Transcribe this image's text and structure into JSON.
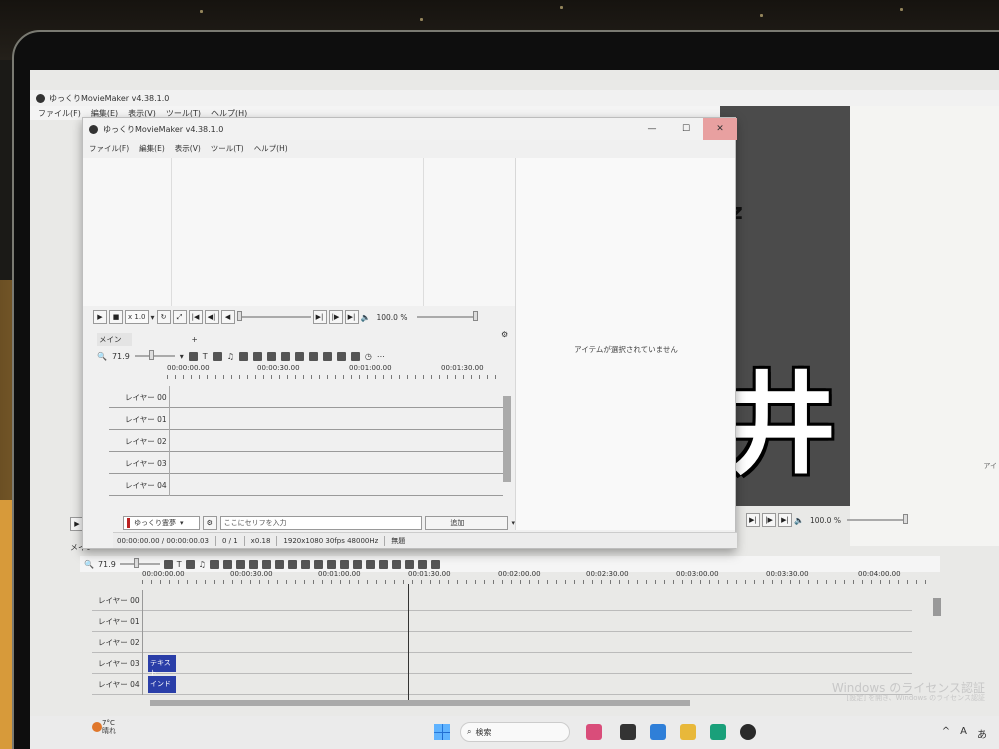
{
  "app": {
    "title": "ゆっくりMovieMaker v4.38.1.0",
    "menu": [
      "ファイル(F)",
      "編集(E)",
      "表示(V)",
      "ツール(T)",
      "ヘルプ(H)"
    ]
  },
  "front_window": {
    "title": "ゆっくりMovieMaker v4.38.1.0",
    "window_buttons": {
      "minimize": "—",
      "maximize": "☐",
      "close": "✕"
    },
    "menu": [
      "ファイル(F)",
      "編集(E)",
      "表示(V)",
      "ツール(T)",
      "ヘルプ(H)"
    ],
    "playback": {
      "speed": "x 1.0",
      "volume": "100.0 %"
    },
    "tabs": {
      "main": "メイン",
      "add": "+"
    },
    "zoom": "71.9",
    "ruler": [
      "00:00:00.00",
      "00:00:30.00",
      "00:01:00.00",
      "00:01:30.00"
    ],
    "layers": [
      "レイヤー 00",
      "レイヤー 01",
      "レイヤー 02",
      "レイヤー 03",
      "レイヤー 04"
    ],
    "character": "ゆっくり霊夢",
    "speech_placeholder": "ここにセリフを入力",
    "add_button": "追加",
    "status": {
      "time": "00:00:00.00 / 00:00:00.03",
      "frame": "0 / 1",
      "scale": "x0.18",
      "format": "1920x1080 30fps 48000Hz",
      "project": "無題"
    },
    "properties_empty": "アイテムが選択されていません"
  },
  "back_window": {
    "tab_main": "メイン",
    "zoom": "71.9",
    "volume": "100.0 %",
    "ruler": [
      "00:00:00.00",
      "00:00:30.00",
      "00:01:00.00",
      "00:01:30.00",
      "00:02:00.00",
      "00:02:30.00",
      "00:03:00.00",
      "00:03:30.00",
      "00:04:00.00"
    ],
    "layers": [
      "レイヤー 00",
      "レイヤー 01",
      "レイヤー 02",
      "レイヤー 03",
      "レイヤー 04"
    ],
    "clips": [
      {
        "layer": 3,
        "label": "テキスト"
      },
      {
        "layer": 4,
        "label": "インド"
      }
    ],
    "right_panel_stub": "アイ",
    "preview_glyph": "井",
    "preview_glyph_top": "z"
  },
  "watermark": {
    "line1": "Windows のライセンス認証",
    "line2": "[設定] を開き、Windows のライセンス認証"
  },
  "taskbar": {
    "weather_temp": "7°C",
    "weather_desc": "晴れ",
    "search_placeholder": "検索",
    "tray_items": [
      "^",
      "A",
      "あ"
    ]
  },
  "colors": {
    "clip": "#2a3ea8",
    "close_hover": "#e8a0a0",
    "taskbar": "#ebebeb"
  }
}
